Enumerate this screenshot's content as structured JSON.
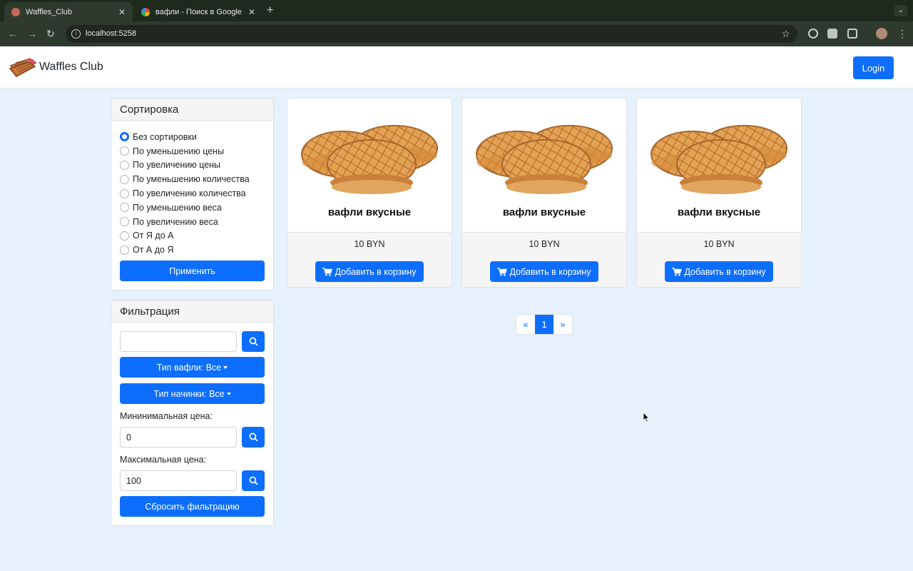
{
  "browser": {
    "tabs": [
      {
        "title": "Waffles_Club",
        "active": true
      },
      {
        "title": "вафли - Поиск в Google",
        "active": false
      }
    ],
    "url": "localhost:5258"
  },
  "navbar": {
    "brand": "Waffles Club",
    "login_label": "Login"
  },
  "sorting": {
    "title": "Сортировка",
    "options": [
      {
        "label": "Без сортировки",
        "checked": true
      },
      {
        "label": "По уменьшению цены",
        "checked": false
      },
      {
        "label": "По увеличению цены",
        "checked": false
      },
      {
        "label": "По уменьшению количества",
        "checked": false
      },
      {
        "label": "По увеличению количества",
        "checked": false
      },
      {
        "label": "По уменьшению веса",
        "checked": false
      },
      {
        "label": "По увеличению веса",
        "checked": false
      },
      {
        "label": "От Я до А",
        "checked": false
      },
      {
        "label": "От А до Я",
        "checked": false
      }
    ],
    "apply_label": "Применить"
  },
  "filter": {
    "title": "Фильтрация",
    "search_value": "",
    "waffle_type_label": "Тип вафли: Все",
    "filling_type_label": "Тип начинки: Все",
    "min_price_label": "Мининимальная цена:",
    "min_price_value": "0",
    "max_price_label": "Максимальная цена:",
    "max_price_value": "100",
    "reset_label": "Сбросить фильтрацию"
  },
  "products": [
    {
      "name": "вафли вкусные",
      "price": "10 BYN",
      "button": "Добавить в корзину"
    },
    {
      "name": "вафли вкусные",
      "price": "10 BYN",
      "button": "Добавить в корзину"
    },
    {
      "name": "вафли вкусные",
      "price": "10 BYN",
      "button": "Добавить в корзину"
    }
  ],
  "pagination": {
    "prev": "«",
    "current": "1",
    "next": "»"
  },
  "colors": {
    "primary": "#0d6efd",
    "page_bg": "#e7f1fb"
  }
}
